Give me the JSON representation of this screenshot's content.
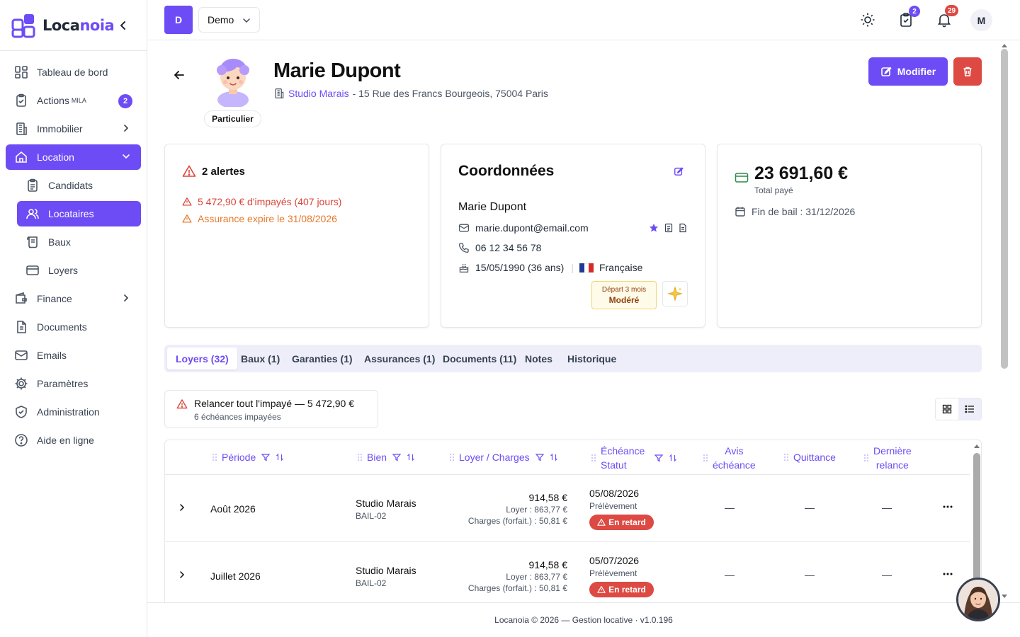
{
  "brand": {
    "name_a": "Loca",
    "name_b": "noia"
  },
  "sidebar": {
    "items": [
      {
        "label": "Tableau de bord"
      },
      {
        "label": "Actions",
        "sup": "MILA",
        "badge": "2"
      },
      {
        "label": "Immobilier"
      },
      {
        "label": "Location"
      },
      {
        "label": "Candidats"
      },
      {
        "label": "Locataires"
      },
      {
        "label": "Baux"
      },
      {
        "label": "Loyers"
      },
      {
        "label": "Finance"
      },
      {
        "label": "Documents"
      },
      {
        "label": "Emails"
      },
      {
        "label": "Paramètres"
      },
      {
        "label": "Administration"
      },
      {
        "label": "Aide en ligne"
      }
    ]
  },
  "topbar": {
    "workspace_initial": "D",
    "workspace_name": "Demo",
    "tasks_badge": "2",
    "notif_badge": "29",
    "user_initial": "M"
  },
  "profile": {
    "role": "Particulier",
    "name": "Marie Dupont",
    "property_link": "Studio Marais",
    "address": "- 15 Rue des Francs Bourgeois, 75004 Paris",
    "edit_label": "Modifier"
  },
  "alerts": {
    "title": "2 alertes",
    "items": [
      {
        "text": "5 472,90 € d'impayés (407 jours)",
        "color": "#d9453a"
      },
      {
        "text": "Assurance expire le 31/08/2026",
        "color": "#e8792b"
      }
    ]
  },
  "contact": {
    "title": "Coordonnées",
    "name": "Marie Dupont",
    "email": "marie.dupont@email.com",
    "phone": "06 12 34 56 78",
    "birth": "15/05/1990 (36 ans)",
    "nationality": "Française",
    "risk_line1": "Départ 3 mois",
    "risk_line2": "Modéré"
  },
  "finance": {
    "total": "23 691,60 €",
    "total_label": "Total payé",
    "lease_end": "Fin de bail : 31/12/2026"
  },
  "tabs": [
    {
      "label": "Loyers (32)"
    },
    {
      "label": "Baux (1)"
    },
    {
      "label": "Garanties (1)"
    },
    {
      "label": "Assurances (1)"
    },
    {
      "label": "Documents (11)"
    },
    {
      "label": "Notes"
    },
    {
      "label": "Historique"
    }
  ],
  "relance": {
    "title": "Relancer tout l'impayé — 5 472,90 €",
    "subtitle": "6 échéances impayées"
  },
  "table": {
    "headers": {
      "periode": "Période",
      "bien": "Bien",
      "loyer": "Loyer / Charges",
      "echeance_1": "Échéance",
      "echeance_2": "Statut",
      "avis_1": "Avis",
      "avis_2": "échéance",
      "quittance": "Quittance",
      "relance_1": "Dernière",
      "relance_2": "relance"
    },
    "rows": [
      {
        "period": "Août 2026",
        "bien": "Studio Marais",
        "bail": "BAIL-02",
        "amount": "914,58 €",
        "loyer": "Loyer : 863,77 €",
        "charges": "Charges (forfait.) : 50,81 €",
        "date": "05/08/2026",
        "mode": "Prélèvement",
        "status": "En retard",
        "avis": "—",
        "quittance": "—",
        "relance": "—"
      },
      {
        "period": "Juillet 2026",
        "bien": "Studio Marais",
        "bail": "BAIL-02",
        "amount": "914,58 €",
        "loyer": "Loyer : 863,77 €",
        "charges": "Charges (forfait.) : 50,81 €",
        "date": "05/07/2026",
        "mode": "Prélèvement",
        "status": "En retard",
        "avis": "—",
        "quittance": "—",
        "relance": "—"
      }
    ]
  },
  "footer": "Locanoia © 2026 — Gestion locative · v1.0.196",
  "colors": {
    "accent": "#6d4cf5",
    "danger": "#dc4a43",
    "warning": "#e8792b"
  }
}
